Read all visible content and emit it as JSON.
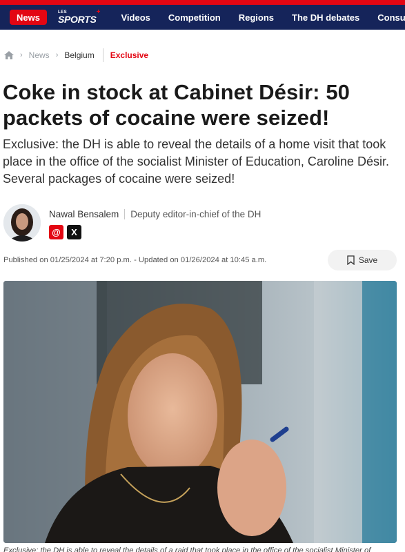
{
  "nav": {
    "news": "News",
    "sports_small": "LES",
    "sports": "SPORTS",
    "sports_plus": "+",
    "items": [
      "Videos",
      "Competition",
      "Regions",
      "The DH debates",
      "Consump"
    ]
  },
  "breadcrumb": {
    "home_icon": "home-icon",
    "items": [
      "News",
      "Belgium"
    ],
    "tag": "Exclusive"
  },
  "article": {
    "title": "Coke in stock at Cabinet Désir: 50 packets of cocaine were seized!",
    "lead": "Exclusive: the DH is able to reveal the details of a home visit that took place in the office of the socialist Minister of Education, Caroline Désir. Several packages of cocaine were seized!",
    "author_name": "Nawal Bensalem",
    "author_role": "Deputy editor-in-chief of the DH",
    "social": [
      "@",
      "X"
    ],
    "published": "Published on 01/25/2024 at 7:20 p.m. - Updated on 01/26/2024 at 10:45 a.m.",
    "save_label": "Save",
    "caption": "Exclusive: the DH is able to reveal the details of a raid that took place in the office of the socialist Minister of Education, Caroline Désir. Several packages of cocaine were seized! © Jacques Duchateau"
  },
  "colors": {
    "accent": "#e30613",
    "nav_bg": "#15245a"
  }
}
